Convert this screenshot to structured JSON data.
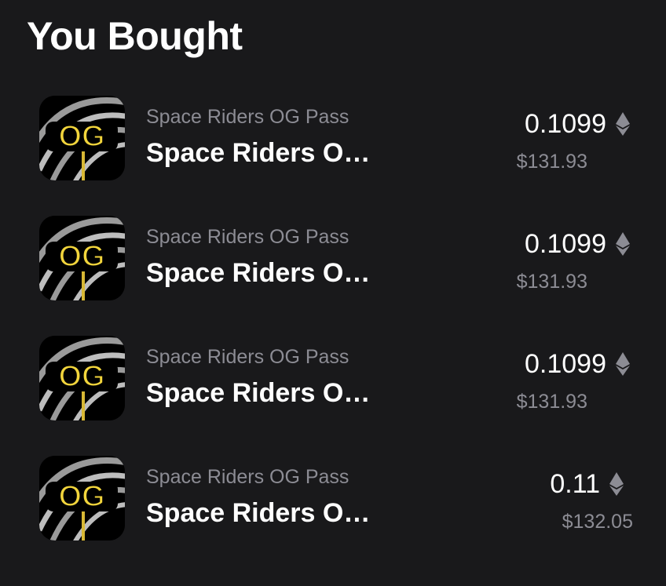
{
  "header": {
    "title": "You Bought"
  },
  "items": [
    {
      "collection": "Space Riders OG Pass",
      "name": "Space Riders OG Pass",
      "price": "0.1099",
      "usd": "$131.93",
      "currency_icon": "ethereum-icon",
      "thumbnail_label": "OG"
    },
    {
      "collection": "Space Riders OG Pass",
      "name": "Space Riders OG Pass",
      "price": "0.1099",
      "usd": "$131.93",
      "currency_icon": "ethereum-icon",
      "thumbnail_label": "OG"
    },
    {
      "collection": "Space Riders OG Pass",
      "name": "Space Riders OG Pass",
      "price": "0.1099",
      "usd": "$131.93",
      "currency_icon": "ethereum-icon",
      "thumbnail_label": "OG"
    },
    {
      "collection": "Space Riders OG Pass",
      "name": "Space Riders OG Pass",
      "price": "0.11",
      "usd": "$132.05",
      "currency_icon": "ethereum-icon",
      "thumbnail_label": "OG"
    }
  ],
  "colors": {
    "background": "#19191b",
    "primary_text": "#ffffff",
    "secondary_text": "#8c8c94",
    "og_yellow": "#f2d53c",
    "eth_icon": "#8c8c94"
  }
}
